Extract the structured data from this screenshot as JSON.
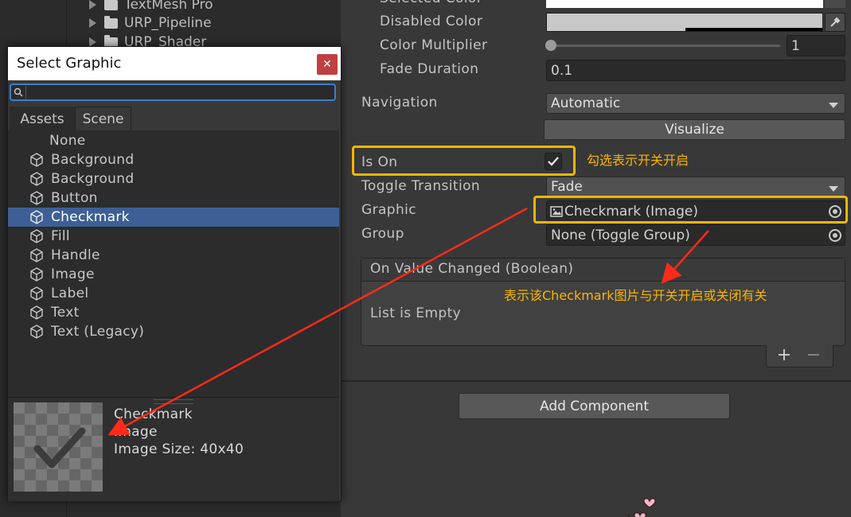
{
  "project_tree": {
    "items": [
      {
        "label": "TextMesh Pro"
      },
      {
        "label": "URP_Pipeline"
      },
      {
        "label": "URP_Shader"
      }
    ]
  },
  "inspector": {
    "selected_color_label": "Selected Color",
    "disabled_color_label": "Disabled Color",
    "color_multiplier_label": "Color Multiplier",
    "color_multiplier_value": "1",
    "fade_duration_label": "Fade Duration",
    "fade_duration_value": "0.1",
    "navigation_label": "Navigation",
    "navigation_value": "Automatic",
    "visualize_label": "Visualize",
    "is_on_label": "Is On",
    "is_on_checked": true,
    "toggle_transition_label": "Toggle Transition",
    "toggle_transition_value": "Fade",
    "graphic_label": "Graphic",
    "graphic_value": "Checkmark (Image)",
    "group_label": "Group",
    "group_value": "None (Toggle Group)",
    "event_header": "On Value Changed (Boolean)",
    "event_empty": "List is Empty",
    "add_label": "+",
    "remove_label": "−",
    "add_component_label": "Add Component"
  },
  "annotations": {
    "is_on_note": "勾选表示开关开启",
    "graphic_note": "表示该Checkmark图片与开关开启或关闭有关",
    "highlight_color": "#f7b500",
    "arrow_color": "#ff2a1a"
  },
  "dialog": {
    "title": "Select Graphic",
    "close_label": "✕",
    "search_value": "",
    "tabs": [
      {
        "label": "Assets",
        "active": false
      },
      {
        "label": "Scene",
        "active": true
      }
    ],
    "items": [
      {
        "label": "None",
        "icon": "none"
      },
      {
        "label": "Background",
        "icon": "gameobject-icon"
      },
      {
        "label": "Background",
        "icon": "gameobject-icon"
      },
      {
        "label": "Button",
        "icon": "gameobject-icon"
      },
      {
        "label": "Checkmark",
        "icon": "gameobject-icon",
        "selected": true
      },
      {
        "label": "Fill",
        "icon": "gameobject-icon"
      },
      {
        "label": "Handle",
        "icon": "gameobject-icon"
      },
      {
        "label": "Image",
        "icon": "gameobject-icon"
      },
      {
        "label": "Label",
        "icon": "gameobject-icon"
      },
      {
        "label": "Text",
        "icon": "gameobject-icon"
      },
      {
        "label": "Text (Legacy)",
        "icon": "gameobject-icon"
      }
    ],
    "preview": {
      "name": "Checkmark",
      "type": "Image",
      "size": "Image Size: 40x40"
    }
  }
}
